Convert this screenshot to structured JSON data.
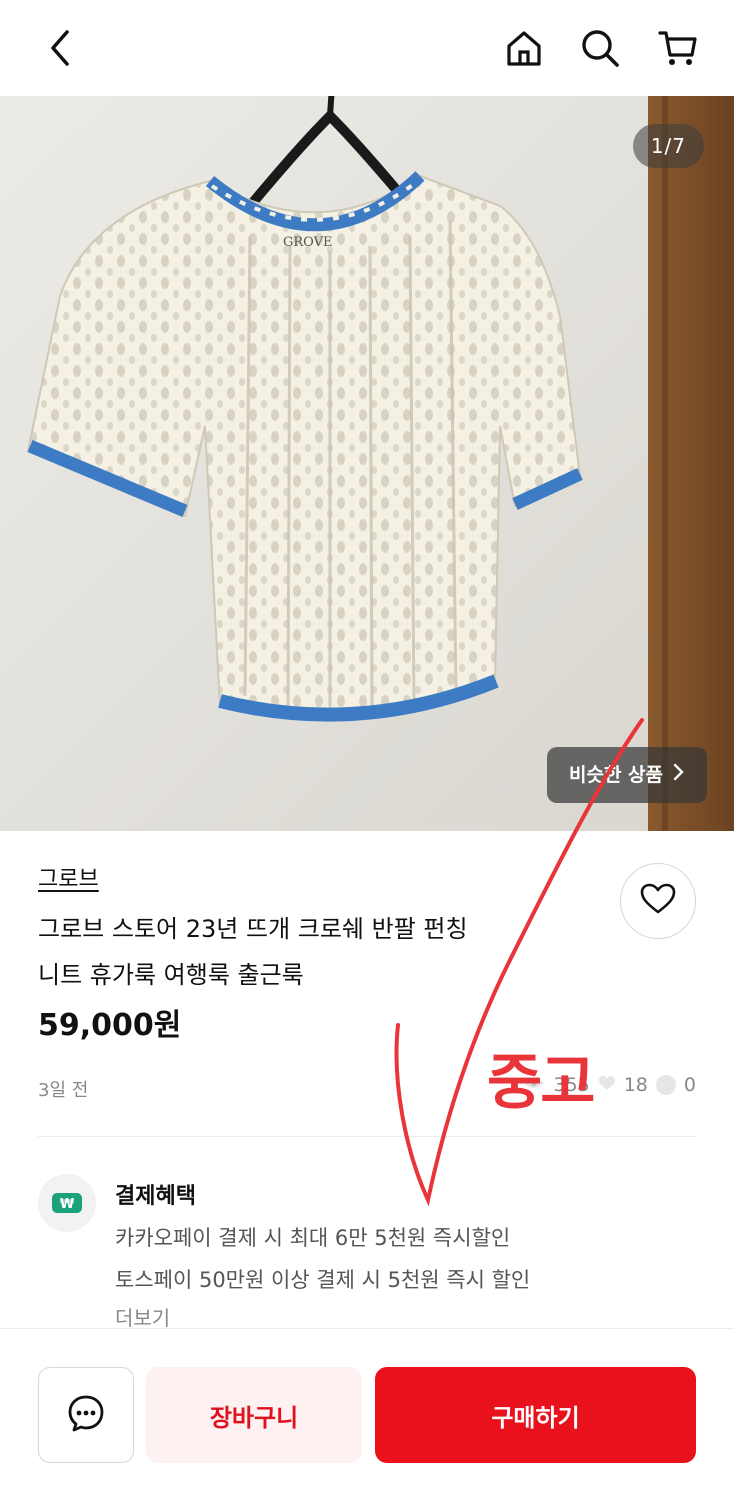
{
  "header": {
    "icons": [
      "back-icon",
      "home-icon",
      "search-icon",
      "cart-icon"
    ]
  },
  "gallery": {
    "counter": "1/7",
    "similar_label": "비슷한 상품",
    "label_on_garment": "GROVE"
  },
  "product": {
    "brand": "그로브",
    "title_line1": "그로브 스토어 23년 뜨개 크로쉐 반팔 펀칭",
    "title_line2": "니트 휴가룩 여행룩 출근룩",
    "price": "59,000원",
    "posted": "3일 전",
    "views": "355",
    "likes": "18",
    "chats": "0"
  },
  "payment": {
    "title": "결제혜택",
    "lines": [
      "카카오페이 결제 시 최대 6만 5천원 즉시할인",
      "토스페이 50만원 이상 결제 시 5천원 즉시 할인"
    ],
    "more": "더보기",
    "icon": "won-coin-icon"
  },
  "bottom_bar": {
    "cart_label": "장바구니",
    "buy_label": "구매하기",
    "chat_icon": "chat-icon"
  },
  "annotation": {
    "text": "중고",
    "color": "#e9353a"
  },
  "colors": {
    "accent": "#e9111c",
    "cart_bg": "#fdf1f1",
    "knit_blue": "#3d7cc4",
    "knit_cream": "#f4f0e4"
  }
}
